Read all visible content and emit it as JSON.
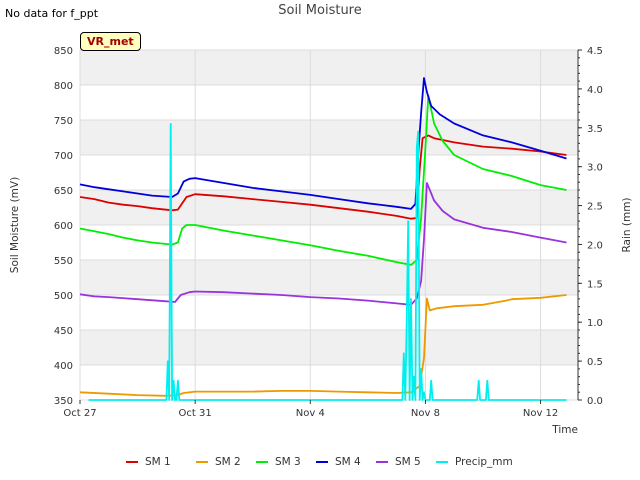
{
  "note": "No data for f_ppt",
  "badge": "VR_met",
  "chart_data": {
    "type": "line",
    "title": "Soil Moisture",
    "xlabel": "Time",
    "ylabel": "Soil Moisture (mV)",
    "y2label": "Rain (mm)",
    "x_tick_labels": [
      "Oct 27",
      "Oct 31",
      "Nov 4",
      "Nov 8",
      "Nov 12"
    ],
    "xlim_days": [
      0,
      17.3
    ],
    "x_unit": "days since Oct 27",
    "ylim": [
      350,
      850
    ],
    "yticks": [
      350,
      400,
      450,
      500,
      550,
      600,
      650,
      700,
      750,
      800,
      850
    ],
    "y2lim": [
      0,
      4.5
    ],
    "y2ticks": [
      0.0,
      0.5,
      1.0,
      1.5,
      2.0,
      2.5,
      3.0,
      3.5,
      4.0,
      4.5
    ],
    "grid": true,
    "legend_position": "bottom",
    "series": [
      {
        "name": "SM 1",
        "color": "#dd0000",
        "axis": "left",
        "x": [
          0,
          0.5,
          1,
          1.5,
          2,
          2.5,
          3.2,
          3.4,
          3.7,
          4,
          5,
          6,
          7,
          8,
          9,
          10,
          11,
          11.5,
          11.7,
          11.8,
          11.9,
          12.1,
          12.3,
          13,
          14,
          15,
          16,
          16.9
        ],
        "y": [
          640,
          637,
          632,
          629,
          627,
          624,
          621,
          622,
          640,
          644,
          641,
          637,
          633,
          629,
          624,
          619,
          613,
          609,
          610,
          680,
          724,
          728,
          724,
          718,
          712,
          709,
          705,
          700
        ]
      },
      {
        "name": "SM 2",
        "color": "#ee9900",
        "axis": "left",
        "x": [
          0,
          1,
          2,
          3,
          3.4,
          3.6,
          4,
          5,
          6,
          7,
          8,
          9,
          10,
          11,
          11.5,
          11.8,
          11.95,
          12.05,
          12.15,
          12.4,
          13,
          14,
          14.8,
          15,
          16,
          16.9
        ],
        "y": [
          361,
          359,
          357,
          356,
          357,
          360,
          362,
          362,
          362,
          363,
          363,
          362,
          361,
          360,
          361,
          370,
          410,
          495,
          478,
          481,
          484,
          486,
          492,
          494,
          496,
          500
        ]
      },
      {
        "name": "SM 3",
        "color": "#00ee00",
        "axis": "left",
        "x": [
          0,
          0.5,
          1,
          1.5,
          2,
          2.5,
          3.2,
          3.4,
          3.55,
          3.7,
          4,
          5,
          6,
          7,
          8,
          9,
          10,
          11,
          11.5,
          11.7,
          11.85,
          12.0,
          12.1,
          12.3,
          12.6,
          13,
          14,
          15,
          16,
          16.9
        ],
        "y": [
          595,
          591,
          587,
          582,
          578,
          575,
          572,
          575,
          595,
          600,
          600,
          592,
          585,
          578,
          571,
          563,
          556,
          547,
          543,
          550,
          610,
          710,
          785,
          745,
          720,
          700,
          680,
          670,
          657,
          650
        ]
      },
      {
        "name": "SM 4",
        "color": "#0000dd",
        "axis": "left",
        "x": [
          0,
          0.5,
          1,
          1.5,
          2,
          2.5,
          3.2,
          3.4,
          3.6,
          3.8,
          4,
          5,
          6,
          7,
          8,
          9,
          10,
          11,
          11.5,
          11.65,
          11.75,
          11.85,
          11.95,
          12.05,
          12.2,
          12.5,
          13,
          14,
          15,
          16,
          16.9
        ],
        "y": [
          658,
          654,
          651,
          648,
          645,
          642,
          640,
          645,
          662,
          666,
          667,
          660,
          653,
          648,
          643,
          637,
          631,
          626,
          623,
          630,
          700,
          760,
          810,
          790,
          770,
          758,
          745,
          728,
          718,
          706,
          695
        ]
      },
      {
        "name": "SM 5",
        "color": "#9933dd",
        "axis": "left",
        "x": [
          0,
          0.5,
          1,
          2,
          3,
          3.3,
          3.5,
          3.8,
          4,
          5,
          6,
          7,
          8,
          9,
          10,
          11,
          11.5,
          11.7,
          11.85,
          11.95,
          12.05,
          12.15,
          12.3,
          12.6,
          13,
          14,
          15,
          16,
          16.9
        ],
        "y": [
          501,
          498,
          497,
          494,
          491,
          490,
          500,
          504,
          505,
          504,
          502,
          500,
          497,
          495,
          492,
          488,
          486,
          495,
          520,
          580,
          660,
          650,
          635,
          620,
          608,
          596,
          590,
          582,
          575
        ]
      },
      {
        "name": "Precip_mm",
        "color": "#00eeee",
        "axis": "right",
        "x": [
          0.3,
          3.0,
          3.05,
          3.1,
          3.15,
          3.2,
          3.25,
          3.3,
          3.35,
          3.4,
          3.45,
          11.2,
          11.25,
          11.3,
          11.35,
          11.4,
          11.45,
          11.5,
          11.55,
          11.6,
          11.65,
          11.7,
          11.75,
          11.8,
          11.85,
          11.9,
          11.95,
          12.0,
          12.05,
          12.1,
          12.15,
          12.2,
          12.25,
          12.3,
          12.35,
          12.4,
          13.8,
          13.85,
          13.9,
          14.1,
          14.15,
          14.2,
          16.9
        ],
        "y": [
          0,
          0,
          0.5,
          0,
          3.55,
          0,
          0.25,
          0,
          0,
          0.25,
          0,
          0,
          0.6,
          0,
          1.0,
          2.3,
          0,
          1.3,
          0,
          0.3,
          0,
          3.25,
          3.45,
          0,
          0.4,
          0,
          0.1,
          0,
          0,
          0,
          0,
          0.25,
          0,
          0,
          0,
          0,
          0,
          0.25,
          0,
          0,
          0.25,
          0,
          0
        ]
      }
    ]
  }
}
